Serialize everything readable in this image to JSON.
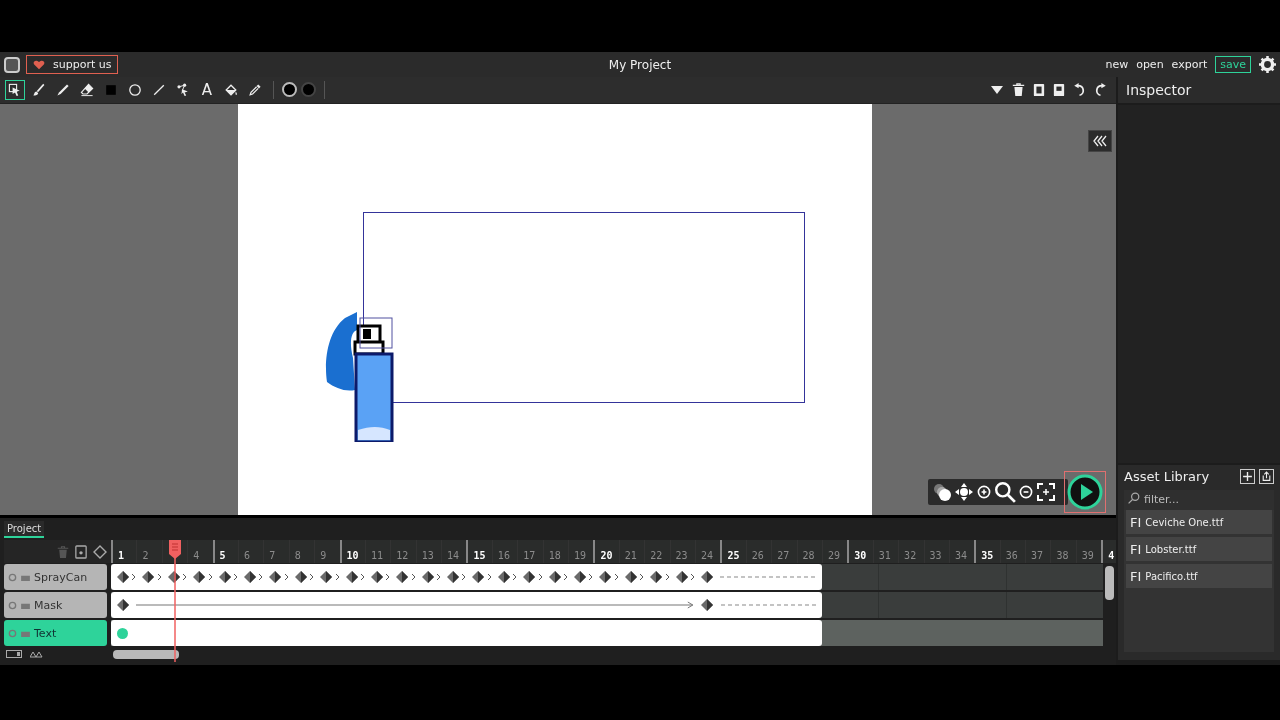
{
  "menubar": {
    "support_label": "support us",
    "title": "My Project",
    "actions": [
      {
        "label": "new",
        "kind": "link"
      },
      {
        "label": "open",
        "kind": "link"
      },
      {
        "label": "export",
        "kind": "link"
      },
      {
        "label": "save",
        "kind": "primary"
      }
    ]
  },
  "toolbar": {
    "tools": [
      {
        "kind": "select",
        "selected": true
      },
      {
        "kind": "brush",
        "selected": false
      },
      {
        "kind": "pencil",
        "selected": false
      },
      {
        "kind": "eraser",
        "selected": false
      },
      {
        "kind": "rectangle",
        "selected": false
      },
      {
        "kind": "ellipse",
        "selected": false
      },
      {
        "kind": "line",
        "selected": false
      },
      {
        "kind": "path",
        "selected": false
      },
      {
        "kind": "text",
        "glyph": "A",
        "selected": false
      },
      {
        "kind": "fill",
        "selected": false
      },
      {
        "kind": "eyedropper",
        "selected": false
      }
    ],
    "swatches": [
      {
        "kind": "stroke",
        "color": "#000000"
      },
      {
        "kind": "fill",
        "color": "#000000"
      }
    ]
  },
  "inspector": {
    "title": "Inspector"
  },
  "asset_library": {
    "title": "Asset Library",
    "placeholder": "filter...",
    "assets": [
      {
        "badge": "FI",
        "name": "Ceviche One.ttf"
      },
      {
        "badge": "FI",
        "name": "Lobster.ttf"
      },
      {
        "badge": "FI",
        "name": "Pacifico.ttf"
      }
    ]
  },
  "timeline": {
    "tab": "Project",
    "ruler": [
      {
        "label": "1",
        "major": true,
        "selected": false
      },
      {
        "label": "2",
        "major": false,
        "selected": false
      },
      {
        "major": false,
        "selected": true
      },
      {
        "label": "4",
        "major": false,
        "selected": false
      },
      {
        "label": "5",
        "major": true,
        "selected": false
      },
      {
        "label": "6",
        "major": false,
        "selected": false
      },
      {
        "label": "7",
        "major": false,
        "selected": false
      },
      {
        "label": "8",
        "major": false,
        "selected": false
      },
      {
        "label": "9",
        "major": false,
        "selected": false
      },
      {
        "label": "10",
        "major": true,
        "selected": false
      },
      {
        "label": "11",
        "major": false,
        "selected": false
      },
      {
        "label": "12",
        "major": false,
        "selected": false
      },
      {
        "label": "13",
        "major": false,
        "selected": false
      },
      {
        "label": "14",
        "major": false,
        "selected": false
      },
      {
        "label": "15",
        "major": true,
        "selected": false
      },
      {
        "label": "16",
        "major": false,
        "selected": false
      },
      {
        "label": "17",
        "major": false,
        "selected": false
      },
      {
        "label": "18",
        "major": false,
        "selected": false
      },
      {
        "label": "19",
        "major": false,
        "selected": false
      },
      {
        "label": "20",
        "major": true,
        "selected": false
      },
      {
        "label": "21",
        "major": false,
        "selected": false
      },
      {
        "label": "22",
        "major": false,
        "selected": false
      },
      {
        "label": "23",
        "major": false,
        "selected": false
      },
      {
        "label": "24",
        "major": false,
        "selected": false
      },
      {
        "label": "25",
        "major": true,
        "selected": false
      },
      {
        "label": "26",
        "major": false,
        "selected": false
      },
      {
        "label": "27",
        "major": false,
        "selected": false
      },
      {
        "label": "28",
        "major": false,
        "selected": false
      },
      {
        "label": "29",
        "major": false,
        "selected": false
      },
      {
        "label": "30",
        "major": true,
        "selected": false
      },
      {
        "label": "31",
        "major": false,
        "selected": false
      },
      {
        "label": "32",
        "major": false,
        "selected": false
      },
      {
        "label": "33",
        "major": false,
        "selected": false
      },
      {
        "label": "34",
        "major": false,
        "selected": false
      },
      {
        "label": "35",
        "major": true,
        "selected": false
      },
      {
        "label": "36",
        "major": false,
        "selected": false
      },
      {
        "label": "37",
        "major": false,
        "selected": false
      },
      {
        "label": "38",
        "major": false,
        "selected": false
      },
      {
        "label": "39",
        "major": false,
        "selected": false
      },
      {
        "label": "4",
        "major": true,
        "selected": false
      }
    ],
    "layers": [
      {
        "name": "SprayCan",
        "selected": false,
        "frames": [
          {
            "kind": "key"
          },
          {
            "kind": "key"
          },
          {
            "kind": "key"
          },
          {
            "kind": "key"
          },
          {
            "kind": "key"
          },
          {
            "kind": "key"
          },
          {
            "kind": "key"
          },
          {
            "kind": "key"
          },
          {
            "kind": "key"
          },
          {
            "kind": "key"
          },
          {
            "kind": "key"
          },
          {
            "kind": "key"
          },
          {
            "kind": "key"
          },
          {
            "kind": "key"
          },
          {
            "kind": "key"
          },
          {
            "kind": "key"
          },
          {
            "kind": "key"
          },
          {
            "kind": "key"
          },
          {
            "kind": "key"
          },
          {
            "kind": "key"
          },
          {
            "kind": "key"
          },
          {
            "kind": "key"
          },
          {
            "kind": "key"
          },
          {
            "kind": "key"
          },
          {
            "kind": "hold"
          },
          {
            "kind": "hold"
          },
          {
            "kind": "hold"
          },
          {
            "kind": "hold"
          }
        ]
      },
      {
        "name": "Mask",
        "selected": false,
        "frames": [
          {
            "kind": "key"
          },
          {
            "kind": "tween"
          },
          {
            "kind": "tween"
          },
          {
            "kind": "tween"
          },
          {
            "kind": "tween"
          },
          {
            "kind": "tween"
          },
          {
            "kind": "tween"
          },
          {
            "kind": "tween"
          },
          {
            "kind": "tween"
          },
          {
            "kind": "tween"
          },
          {
            "kind": "tween"
          },
          {
            "kind": "tween"
          },
          {
            "kind": "tween"
          },
          {
            "kind": "tween"
          },
          {
            "kind": "tween"
          },
          {
            "kind": "tween"
          },
          {
            "kind": "tween"
          },
          {
            "kind": "tween"
          },
          {
            "kind": "tween"
          },
          {
            "kind": "tween"
          },
          {
            "kind": "tween"
          },
          {
            "kind": "tween"
          },
          {
            "kind": "tween"
          },
          {
            "kind": "key"
          },
          {
            "kind": "hold"
          },
          {
            "kind": "hold"
          },
          {
            "kind": "hold"
          },
          {
            "kind": "hold"
          }
        ]
      },
      {
        "name": "Text",
        "selected": true,
        "frames": [
          {
            "kind": "dot"
          },
          {
            "kind": "blank"
          },
          {
            "kind": "blank"
          },
          {
            "kind": "blank"
          },
          {
            "kind": "blank"
          },
          {
            "kind": "blank"
          },
          {
            "kind": "blank"
          },
          {
            "kind": "blank"
          },
          {
            "kind": "blank"
          },
          {
            "kind": "blank"
          },
          {
            "kind": "blank"
          },
          {
            "kind": "blank"
          },
          {
            "kind": "blank"
          },
          {
            "kind": "blank"
          },
          {
            "kind": "blank"
          },
          {
            "kind": "blank"
          },
          {
            "kind": "blank"
          },
          {
            "kind": "blank"
          },
          {
            "kind": "blank"
          },
          {
            "kind": "blank"
          },
          {
            "kind": "blank"
          },
          {
            "kind": "blank"
          },
          {
            "kind": "blank"
          },
          {
            "kind": "blank"
          },
          {
            "kind": "blank"
          },
          {
            "kind": "blank"
          },
          {
            "kind": "blank"
          },
          {
            "kind": "blank"
          }
        ]
      }
    ]
  }
}
